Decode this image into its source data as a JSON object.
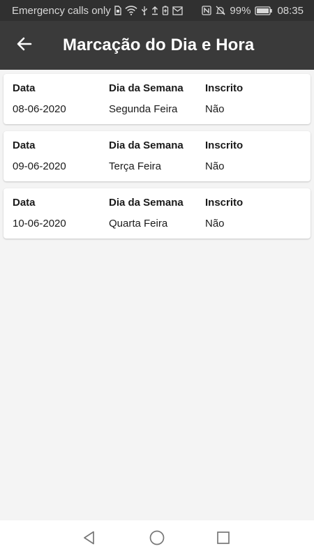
{
  "status_bar": {
    "carrier_text": "Emergency calls only",
    "battery": "99%",
    "time": "08:35",
    "icons": [
      "sim-icon",
      "wifi-icon",
      "usb-icon",
      "upload-icon",
      "battery-saver-icon",
      "mail-icon",
      "nfc-icon",
      "mute-icon",
      "battery-icon"
    ]
  },
  "app_bar": {
    "title": "Marcação do Dia e Hora",
    "back_icon": "arrow-left-icon"
  },
  "columns": {
    "date": "Data",
    "weekday": "Dia da Semana",
    "enrolled": "Inscrito"
  },
  "entries": [
    {
      "date": "08-06-2020",
      "weekday": "Segunda Feira",
      "enrolled": "Não"
    },
    {
      "date": "09-06-2020",
      "weekday": "Terça Feira",
      "enrolled": "Não"
    },
    {
      "date": "10-06-2020",
      "weekday": "Quarta Feira",
      "enrolled": "Não"
    }
  ],
  "nav_bar": {
    "icons": [
      "back-triangle-icon",
      "home-circle-icon",
      "recents-square-icon"
    ]
  },
  "colors": {
    "status_bar_bg": "#303030",
    "app_bar_bg": "#3a3a3a",
    "page_bg": "#f4f4f4",
    "card_bg": "#ffffff"
  }
}
